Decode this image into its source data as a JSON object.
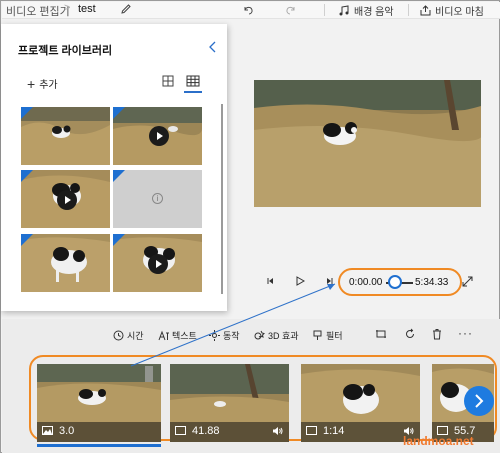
{
  "topbar": {
    "app_title": "비디오 편집기",
    "separator": ">",
    "project_name": "test",
    "background_music": "배경 음악",
    "finish_video": "비디오 마침"
  },
  "library": {
    "title": "프로젝트 라이브러리",
    "add_label": "추가",
    "items": [
      {
        "kind": "image",
        "scene": "cat-field"
      },
      {
        "kind": "video",
        "scene": "grass"
      },
      {
        "kind": "video",
        "scene": "cat-closeup"
      },
      {
        "kind": "placeholder",
        "scene": "empty"
      },
      {
        "kind": "image",
        "scene": "cat-walk"
      },
      {
        "kind": "video",
        "scene": "cat-walk"
      }
    ]
  },
  "player": {
    "current_time": "0:00.00",
    "total_time": "5:34.33",
    "position_fraction": 0.0
  },
  "tools": {
    "duration": "시간",
    "text": "텍스트",
    "motion": "동작",
    "effects_3d": "3D 효과",
    "filter": "필터",
    "more": "···"
  },
  "timeline": {
    "clips": [
      {
        "type": "image",
        "duration": "3.0",
        "audio": false,
        "selected": true
      },
      {
        "type": "video",
        "duration": "41.88",
        "audio": true,
        "selected": false
      },
      {
        "type": "video",
        "duration": "1:14",
        "audio": true,
        "selected": false
      },
      {
        "type": "video",
        "duration": "55.7",
        "audio": false,
        "selected": false
      }
    ]
  },
  "watermark": "landmoa.net",
  "colors": {
    "accent": "#1e6fd0",
    "highlight": "#f08a24"
  }
}
